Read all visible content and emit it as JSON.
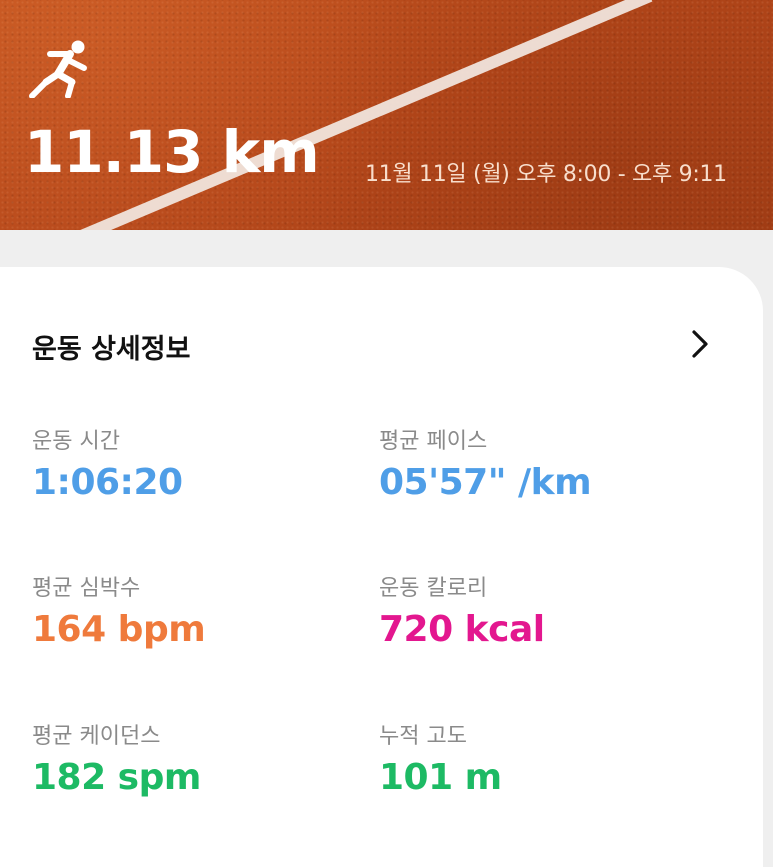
{
  "header": {
    "distance": "11.13 km",
    "datetime": "11월 11일 (월) 오후 8:00 - 오후 9:11",
    "activity_icon": "running-person-icon",
    "background_color": "#b84a1b",
    "track_line_color": "#f1e4dc"
  },
  "details": {
    "title": "운동 상세정보",
    "more_icon": "chevron-right-icon",
    "stats": {
      "duration": {
        "label": "운동 시간",
        "value": "1:06:20",
        "color": "#4f9ee7"
      },
      "pace": {
        "label": "평균 페이스",
        "value": "05'57\" /km",
        "color": "#4f9ee7"
      },
      "heart_rate": {
        "label": "평균 심박수",
        "value": "164 bpm",
        "color": "#ef7a3c"
      },
      "calories": {
        "label": "운동 칼로리",
        "value": "720 kcal",
        "color": "#e3178f"
      },
      "cadence": {
        "label": "평균 케이던스",
        "value": "182 spm",
        "color": "#1dba64"
      },
      "elevation": {
        "label": "누적 고도",
        "value": "101 m",
        "color": "#1dba64"
      }
    }
  }
}
